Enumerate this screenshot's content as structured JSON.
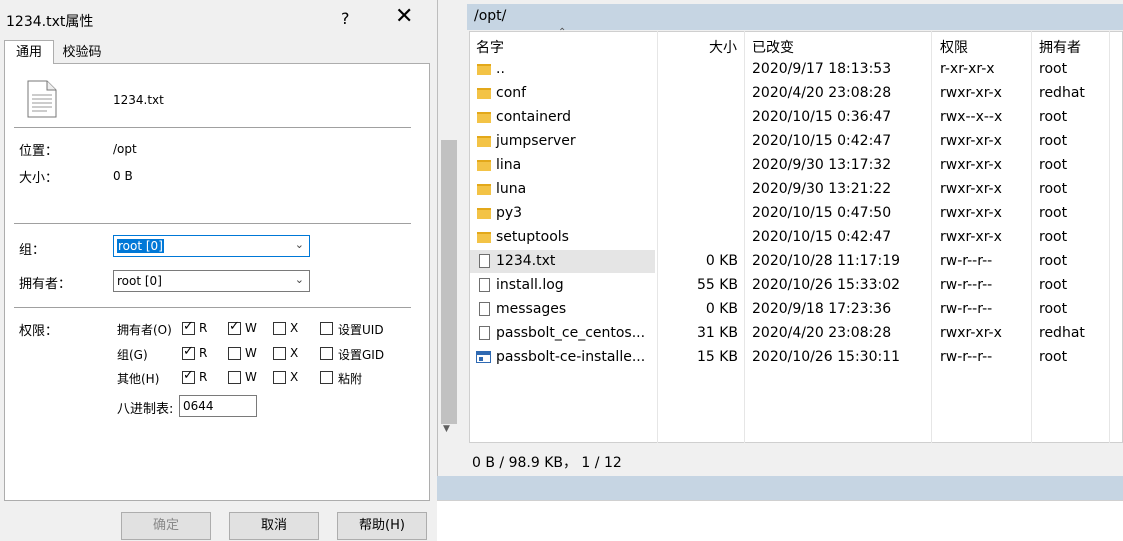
{
  "dialog": {
    "title": "1234.txt属性",
    "help_glyph": "?",
    "close_glyph": "✕",
    "tabs": [
      "通用",
      "校验码"
    ],
    "file_name": "1234.txt",
    "location_label": "位置：",
    "location_value": "/opt",
    "size_label": "大小：",
    "size_value": "0 B",
    "group_label": "组：",
    "group_value": "root [0]",
    "owner_label": "拥有者：",
    "owner_value": "root [0]",
    "perm_label": "权限：",
    "perm_rows": [
      {
        "label": "拥有者(O)",
        "r": true,
        "w": true,
        "x": false,
        "extra": "设置UID",
        "extra_checked": false
      },
      {
        "label": "组(G)",
        "r": true,
        "w": false,
        "x": false,
        "extra": "设置GID",
        "extra_checked": false
      },
      {
        "label": "其他(H)",
        "r": true,
        "w": false,
        "x": false,
        "extra": "粘附",
        "extra_checked": false
      }
    ],
    "perm_letters": {
      "r": "R",
      "w": "W",
      "x": "X"
    },
    "octal_label": "八进制表:",
    "octal_value": "0644",
    "buttons": {
      "ok": "确定",
      "cancel": "取消",
      "help": "帮助(H)"
    }
  },
  "browser": {
    "path": "/opt/",
    "columns": [
      "名字",
      "大小",
      "已改变",
      "权限",
      "拥有者"
    ],
    "rows": [
      {
        "icon": "parent-dir-icon",
        "name": "..",
        "size": "",
        "changed": "2020/9/17 18:13:53",
        "perms": "r-xr-xr-x",
        "owner": "root"
      },
      {
        "icon": "folder-icon",
        "name": "conf",
        "size": "",
        "changed": "2020/4/20 23:08:28",
        "perms": "rwxr-xr-x",
        "owner": "redhat"
      },
      {
        "icon": "folder-icon",
        "name": "containerd",
        "size": "",
        "changed": "2020/10/15 0:36:47",
        "perms": "rwx--x--x",
        "owner": "root"
      },
      {
        "icon": "folder-icon",
        "name": "jumpserver",
        "size": "",
        "changed": "2020/10/15 0:42:47",
        "perms": "rwxr-xr-x",
        "owner": "root"
      },
      {
        "icon": "folder-icon",
        "name": "lina",
        "size": "",
        "changed": "2020/9/30 13:17:32",
        "perms": "rwxr-xr-x",
        "owner": "root"
      },
      {
        "icon": "folder-icon",
        "name": "luna",
        "size": "",
        "changed": "2020/9/30 13:21:22",
        "perms": "rwxr-xr-x",
        "owner": "root"
      },
      {
        "icon": "folder-icon",
        "name": "py3",
        "size": "",
        "changed": "2020/10/15 0:47:50",
        "perms": "rwxr-xr-x",
        "owner": "root"
      },
      {
        "icon": "folder-icon",
        "name": "setuptools",
        "size": "",
        "changed": "2020/10/15 0:42:47",
        "perms": "rwxr-xr-x",
        "owner": "root"
      },
      {
        "icon": "text-file-icon",
        "name": "1234.txt",
        "size": "0 KB",
        "changed": "2020/10/28 11:17:19",
        "perms": "rw-r--r--",
        "owner": "root",
        "selected": true
      },
      {
        "icon": "text-file-icon",
        "name": "install.log",
        "size": "55 KB",
        "changed": "2020/10/26 15:33:02",
        "perms": "rw-r--r--",
        "owner": "root"
      },
      {
        "icon": "text-file-icon",
        "name": "messages",
        "size": "0 KB",
        "changed": "2020/9/18 17:23:36",
        "perms": "rw-r--r--",
        "owner": "root"
      },
      {
        "icon": "file-icon",
        "name": "passbolt_ce_centos...",
        "size": "31 KB",
        "changed": "2020/4/20 23:08:28",
        "perms": "rwxr-xr-x",
        "owner": "redhat"
      },
      {
        "icon": "executable-icon",
        "name": "passbolt-ce-installe...",
        "size": "15 KB",
        "changed": "2020/10/26 15:30:11",
        "perms": "rw-r--r--",
        "owner": "root"
      }
    ],
    "status": "0 B / 98.9 KB， 1 / 12"
  }
}
